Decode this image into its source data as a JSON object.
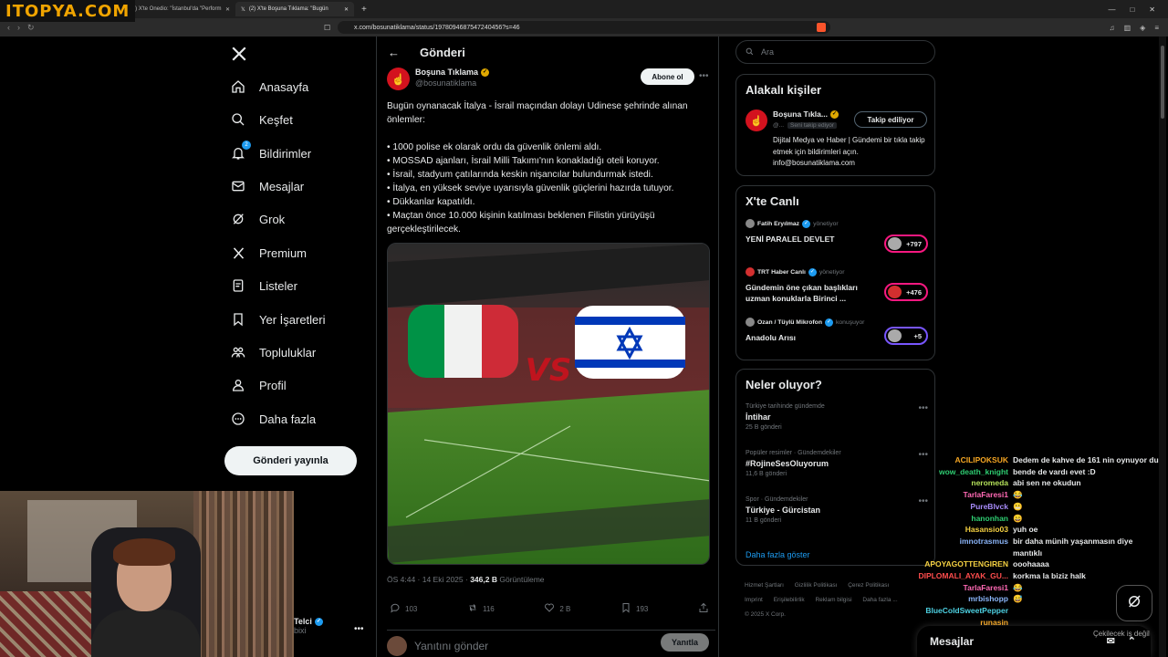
{
  "overlay": {
    "site_logo": "ITOPYA.COM",
    "chat_hint": "Çekilecek iş değil"
  },
  "browser": {
    "tabs": [
      {
        "label": "(2) X'te Onedio: \"İstanbul'da \"Perform",
        "active": false
      },
      {
        "label": "(2) X'te Boşuna Tıklama: \"Bugün",
        "active": true
      }
    ],
    "url": "x.com/bosunatiklama/status/1978094687547240456?s=46"
  },
  "nav": {
    "items": [
      {
        "label": "Anasayfa",
        "icon": "home-icon"
      },
      {
        "label": "Keşfet",
        "icon": "search-icon"
      },
      {
        "label": "Bildirimler",
        "icon": "bell-icon",
        "badge": "2"
      },
      {
        "label": "Mesajlar",
        "icon": "mail-icon"
      },
      {
        "label": "Grok",
        "icon": "grok-icon"
      },
      {
        "label": "Premium",
        "icon": "x-icon"
      },
      {
        "label": "Listeler",
        "icon": "list-icon"
      },
      {
        "label": "Yer İşaretleri",
        "icon": "bookmark-icon"
      },
      {
        "label": "Topluluklar",
        "icon": "communities-icon"
      },
      {
        "label": "Profil",
        "icon": "profile-icon"
      },
      {
        "label": "Daha fazla",
        "icon": "more-circle-icon"
      }
    ],
    "post_button": "Gönderi yayınla"
  },
  "account": {
    "name": "Telci",
    "handle": "bixi"
  },
  "post": {
    "header_title": "Gönderi",
    "author_name": "Boşuna Tıklama",
    "author_handle": "@bosunatiklama",
    "subscribe_label": "Abone ol",
    "text": "Bugün oynanacak İtalya - İsrail maçından dolayı Udinese şehrinde alınan önlemler:\n\n• 1000 polise ek olarak ordu da güvenlik önlemi aldı.\n• MOSSAD ajanları, İsrail Milli Takımı'nın konakladığı oteli koruyor.\n• İsrail, stadyum çatılarında keskin nişancılar bulundurmak istedi.\n• İtalya, en yüksek seviye uyarısıyla güvenlik güçlerini hazırda tutuyor.\n• Dükkanlar kapatıldı.\n• Maçtan önce 10.000 kişinin katılması beklenen Filistin yürüyüşü gerçekleştirilecek.",
    "media_vs": "VS",
    "time": "ÖS 4:44 · 14 Eki 2025 · ",
    "views_count": "346,2 B",
    "views_label": "Görüntüleme",
    "replies": "103",
    "reposts": "116",
    "likes": "2 B",
    "bookmarks": "193",
    "reply_placeholder": "Yanıtını gönder",
    "reply_button": "Yanıtla"
  },
  "sidebar": {
    "search_placeholder": "Ara",
    "related": {
      "title": "Alakalı kişiler",
      "name": "Boşuna Tıkla...",
      "handle": "@...",
      "follows_you": "Seni takip ediyor",
      "follow_label": "Takip ediliyor",
      "bio": "Dijital Medya ve Haber | Gündemi bir tıkla takip etmek için bildirimleri açın. info@bosunatiklama.com"
    },
    "live": {
      "title": "X'te Canlı",
      "items": [
        {
          "host": "Fatih Eryılmaz",
          "status": "yönetiyor",
          "title": "YENİ PARALEL DEVLET",
          "count": "+797"
        },
        {
          "host": "TRT Haber Canlı",
          "status": "yönetiyor",
          "title": "Gündemin öne çıkan başlıkları uzman konuklarla Birinci ...",
          "count": "+476"
        },
        {
          "host": "Ozan / Tüylü Mikrofon",
          "status": "konuşuyor",
          "title": "Anadolu Arısı",
          "count": "+5"
        }
      ]
    },
    "trends": {
      "title": "Neler oluyor?",
      "items": [
        {
          "category": "Türkiye tarihinde gündemde",
          "name": "İntihar",
          "count": "25 B gönderi"
        },
        {
          "category": "Popüler resimler · Gündemdekiler",
          "name": "#RojineSesOluyorum",
          "count": "11,6 B gönderi"
        },
        {
          "category": "Spor · Gündemdekiler",
          "name": "Türkiye - Gürcistan",
          "count": "11 B gönderi"
        }
      ],
      "show_more": "Daha fazla göster"
    },
    "footer": [
      "Hizmet Şartları",
      "Gizlilik Politikası",
      "Çerez Politikası",
      "Imprint",
      "Erişilebilirlik",
      "Reklam bilgisi",
      "Daha fazla ...",
      "© 2025 X Corp."
    ]
  },
  "chat": [
    {
      "user": "ACILIPOKSUK",
      "color": "#f5a623",
      "msg": "Dedem de kahve de 161 nin oynuyor du"
    },
    {
      "user": "wow_death_knight",
      "color": "#2ecc71",
      "msg": "bende de vardı evet :D"
    },
    {
      "user": "neromeda",
      "color": "#b4e05a",
      "msg": "abi sen ne okudun"
    },
    {
      "user": "TarlaFaresi1",
      "color": "#ff69b4",
      "msg": "😂"
    },
    {
      "user": "PureBlvck",
      "color": "#a78bfa",
      "msg": "😬"
    },
    {
      "user": "hanonhan",
      "color": "#2ecc71",
      "msg": "😄"
    },
    {
      "user": "Hasansio03",
      "color": "#f5d142",
      "msg": "yuh oe"
    },
    {
      "user": "imnotrasmus",
      "color": "#8ab4f8",
      "msg": "bir daha münih yaşanmasın diye mantıklı"
    },
    {
      "user": "APOYAGOTTENGIREN",
      "color": "#f5d142",
      "msg": "ooohaaaa"
    },
    {
      "user": "DIPLOMALI_AYAK_GU...",
      "color": "#ff4d4d",
      "msg": "korkma la biziz halk"
    },
    {
      "user": "TarlaFaresi1",
      "color": "#ff69b4",
      "msg": "😂"
    },
    {
      "user": "mrbishopp",
      "color": "#8ab4f8",
      "msg": "😅"
    },
    {
      "user": "BlueColdSweetPepper",
      "color": "#4dd0e1",
      "msg": ""
    },
    {
      "user": "runasin",
      "color": "#f5a623",
      "msg": ""
    }
  ],
  "messages_drawer": {
    "title": "Mesajlar"
  }
}
